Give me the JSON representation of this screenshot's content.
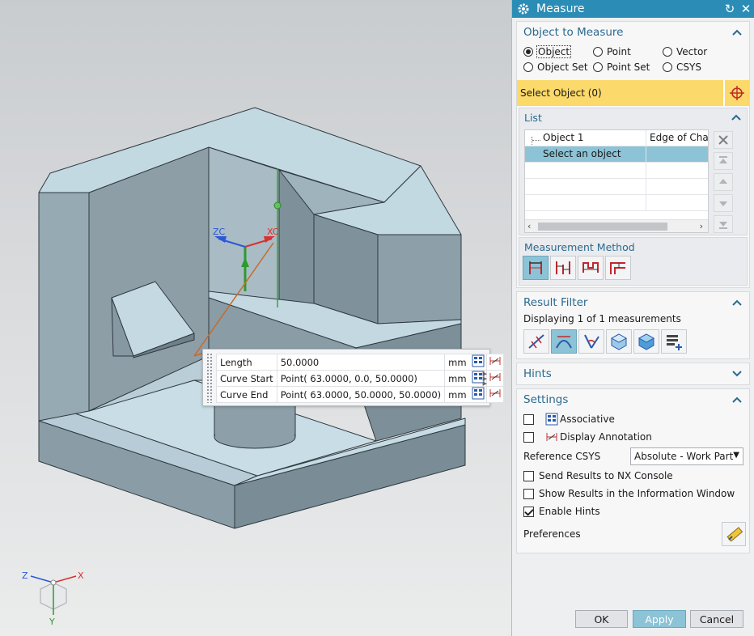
{
  "dialog": {
    "title": "Measure",
    "object_to_measure": {
      "heading": "Object to Measure",
      "radios": [
        {
          "label": "Object",
          "selected": true
        },
        {
          "label": "Point",
          "selected": false
        },
        {
          "label": "Vector",
          "selected": false
        },
        {
          "label": "Object Set",
          "selected": false
        },
        {
          "label": "Point Set",
          "selected": false
        },
        {
          "label": "CSYS",
          "selected": false
        }
      ],
      "select_label": "Select Object (0)",
      "list": {
        "heading": "List",
        "rows": [
          {
            "col1": "Object 1",
            "col2": "Edge of Chamfer"
          },
          {
            "col1": "Select an object",
            "col2": ""
          }
        ]
      },
      "measurement_method": {
        "heading": "Measurement Method",
        "icons": [
          "length-icon",
          "parallel-length-icon",
          "multi-length-icon",
          "step-length-icon"
        ]
      }
    },
    "result_filter": {
      "heading": "Result Filter",
      "status": "Displaying 1 of 1 measurements",
      "icons": [
        "distance-filter-icon",
        "curve-length-filter-icon",
        "angle-filter-icon",
        "area-filter-icon",
        "volume-filter-icon",
        "add-filter-icon"
      ]
    },
    "hints": {
      "heading": "Hints"
    },
    "settings": {
      "heading": "Settings",
      "associative": {
        "label": "Associative",
        "checked": false
      },
      "display_annotation": {
        "label": "Display Annotation",
        "checked": false
      },
      "reference_csys": {
        "label": "Reference CSYS",
        "value": "Absolute - Work Part"
      },
      "send_results": {
        "label": "Send Results to NX Console",
        "checked": false
      },
      "show_results": {
        "label": "Show Results in the Information Window",
        "checked": false
      },
      "enable_hints": {
        "label": "Enable Hints",
        "checked": true
      },
      "preferences_label": "Preferences"
    },
    "buttons": {
      "ok": "OK",
      "apply": "Apply",
      "cancel": "Cancel"
    }
  },
  "viewport": {
    "axes": {
      "zc": "ZC",
      "xc": "XC"
    },
    "triad": {
      "z": "Z",
      "x": "X",
      "y": "Y"
    },
    "measurements": [
      {
        "name": "Length",
        "value": "50.0000",
        "unit": "mm"
      },
      {
        "name": "Curve Start",
        "value": "Point( 63.0000, 0.0, 50.0000)",
        "unit": "mm"
      },
      {
        "name": "Curve End",
        "value": "Point( 63.0000, 50.0000, 50.0000)",
        "unit": "mm"
      }
    ]
  },
  "colors": {
    "titlebar": "#2b8db5",
    "select_highlight": "#fbd96a",
    "selection": "#8cc3d6",
    "model_top": "#c3d9e1",
    "model_side": "#8fa2ac",
    "model_dark": "#6f7f88"
  }
}
